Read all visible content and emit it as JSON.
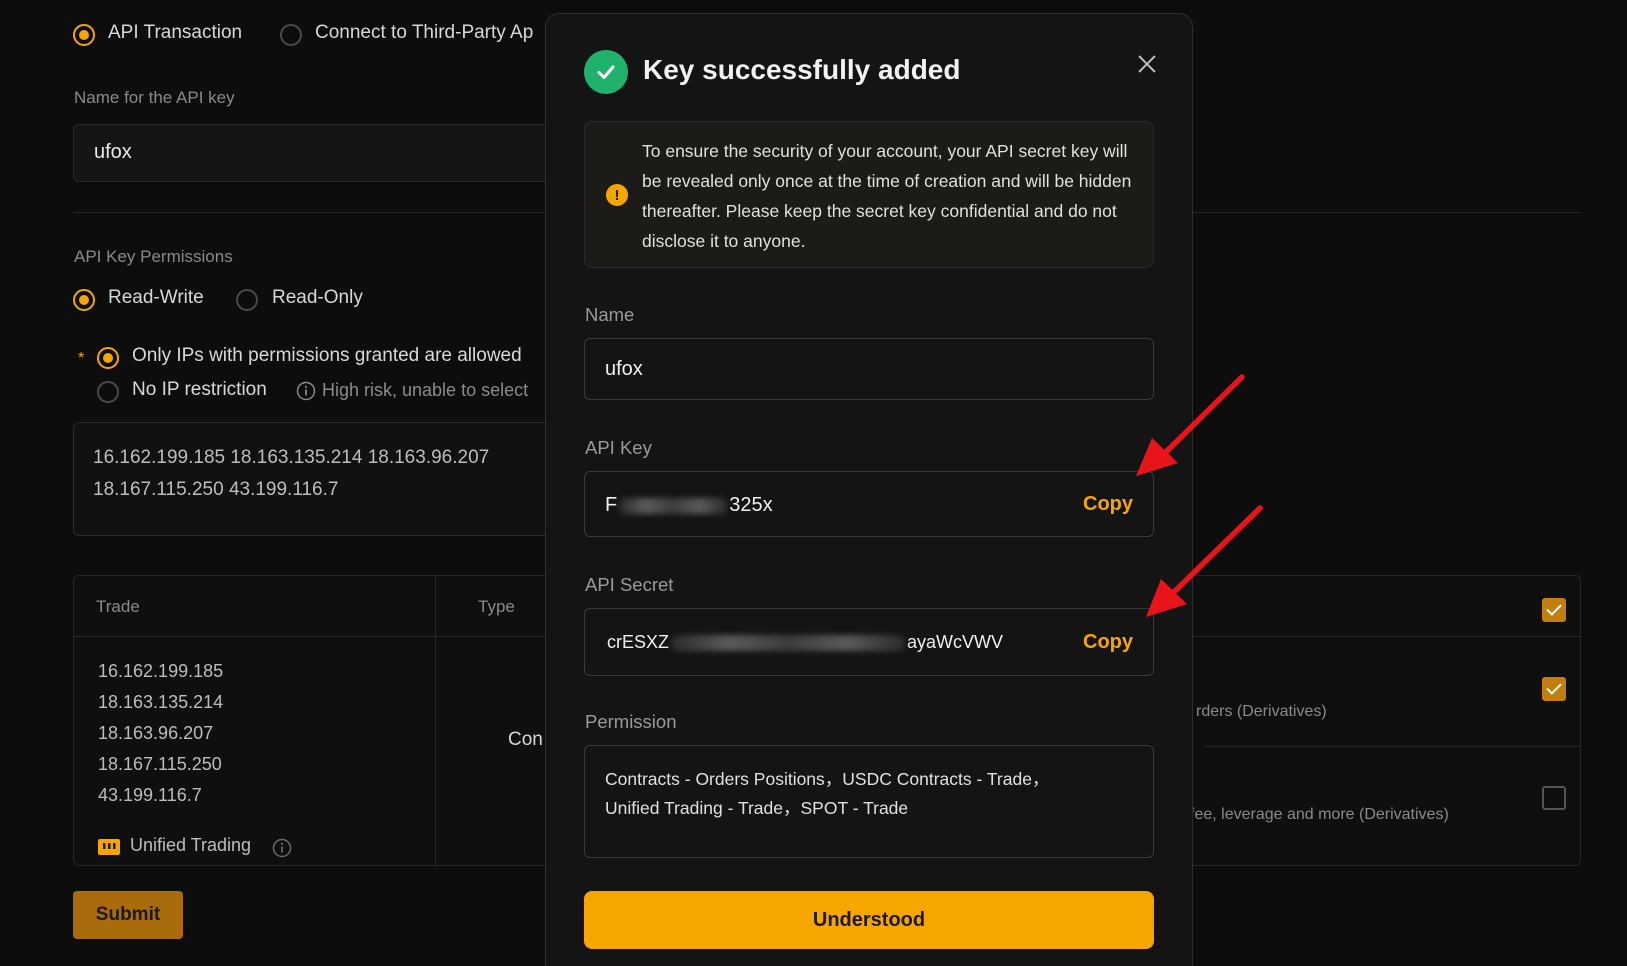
{
  "background": {
    "tabs": [
      {
        "label": "API Transaction",
        "selected": true
      },
      {
        "label": "Connect to Third-Party Ap",
        "selected": false
      }
    ],
    "name_label": "Name for the API key",
    "name_value": "ufox",
    "permissions_label": "API Key Permissions",
    "permission_options": [
      {
        "label": "Read-Write",
        "selected": true
      },
      {
        "label": "Read-Only",
        "selected": false
      }
    ],
    "required_mark": "*",
    "ip_options": [
      {
        "label": "Only IPs with permissions granted are allowed",
        "selected": true
      },
      {
        "label": "No IP restriction",
        "selected": false
      }
    ],
    "ip_risk_note": "High risk, unable to select",
    "ip_lines": [
      "16.162.199.185  18.163.135.214  18.163.96.207",
      "18.167.115.250  43.199.116.7"
    ],
    "table": {
      "headers": [
        "Trade",
        "Type"
      ],
      "ips": [
        "16.162.199.185",
        "18.163.135.214",
        "18.163.96.207",
        "18.167.115.250",
        "43.199.116.7"
      ],
      "type_partial": "Con",
      "row2_desc_partial": "rders (Derivatives)",
      "row3_desc_partial": "fee, leverage and more (Derivatives)",
      "unified_label": "Unified Trading",
      "checkboxes": [
        true,
        true,
        false
      ]
    },
    "submit_label": "Submit"
  },
  "modal": {
    "title": "Key successfully added",
    "notice": "To ensure the security of your account, your API secret key will be revealed only once at the time of creation and will be hidden thereafter. Please keep the secret key confidential and do not disclose it to anyone.",
    "name_label": "Name",
    "name_value": "ufox",
    "api_key_label": "API Key",
    "api_key_start": "F",
    "api_key_end": "325x",
    "api_secret_label": "API Secret",
    "api_secret_start": "crESXZ",
    "api_secret_end": "ayaWcVWV",
    "copy_label": "Copy",
    "permission_label": "Permission",
    "permission_lines": [
      "Contracts - Orders Positions，USDC Contracts - Trade，",
      "Unified Trading - Trade，SPOT - Trade"
    ],
    "confirm_label": "Understood"
  },
  "colors": {
    "accent": "#f7a600",
    "success": "#20b26c",
    "annotation_arrow": "#e8141a"
  },
  "icons": [
    "check-circle-icon",
    "close-icon",
    "info-icon",
    "unified-trading-icon",
    "annotation-arrow"
  ]
}
